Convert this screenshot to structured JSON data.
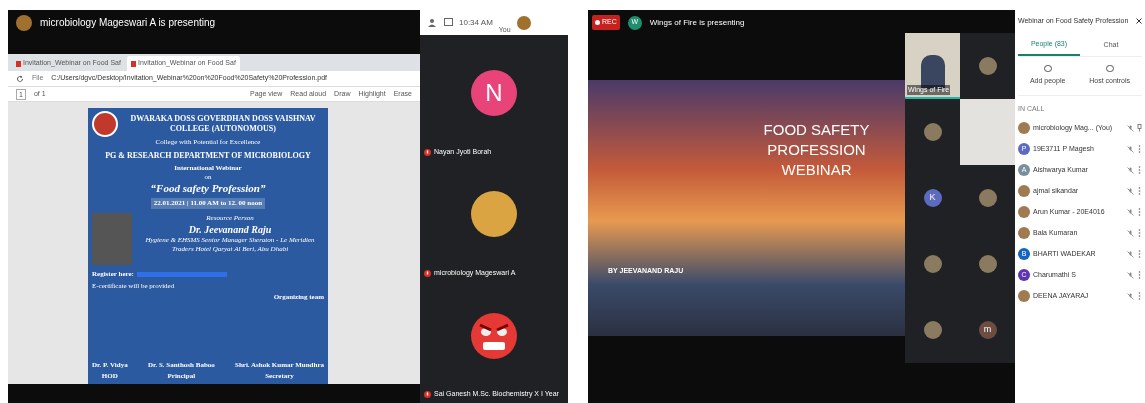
{
  "left_meeting": {
    "presenter_banner": "microbiology Mageswari A is presenting",
    "clock": "10:34 AM",
    "self_label": "You",
    "browser": {
      "tabs": [
        {
          "label": "Invitation_Webinar on Food Saf",
          "selected": false
        },
        {
          "label": "Invitation_Webinar on Food Saf",
          "selected": true
        }
      ],
      "file_label": "File",
      "address": "C:/Users/dgvc/Desktop/Invitation_Webinar%20on%20Food%20Safety%20Profession.pdf",
      "page_number": "1",
      "page_count": "of 1",
      "toolbar": [
        "Page view",
        "Read aloud",
        "Draw",
        "Highlight",
        "Erase"
      ]
    },
    "poster": {
      "college": "DWARAKA DOSS GOVERDHAN DOSS VAISHNAV COLLEGE (AUTONOMOUS)",
      "tagline": "College with Potential for Excellence",
      "department": "PG & RESEARCH DEPARTMENT OF MICROBIOLOGY",
      "event": "International Webinar",
      "on": "on",
      "topic": "“Food safety Profession”",
      "date": "22.01.2021 | 11.00 AM to 12. 00 noon",
      "resource_label": "Resource Person",
      "speaker": "Dr. Jeevanand Raju",
      "speaker_details": "Hygiene & EHSMS Senior Manager Sheraton - Le Meridien Traders Hotel Qaryat Al Beri, Abu Dhabi",
      "register": "Register here:",
      "certificate": "E-certificate will be provided",
      "organizing": "Organizing team",
      "signatories": [
        {
          "name": "Dr. P. Vidya",
          "role": "HOD"
        },
        {
          "name": "Dr. S. Santhosh Baboo",
          "role": "Principal"
        },
        {
          "name": "Shri. Ashok Kumar Mundhra",
          "role": "Secretary"
        }
      ]
    },
    "tiles": [
      {
        "name": "Nayan Jyoti Borah",
        "kind": "initial",
        "initial": "N",
        "color": "#e8447a"
      },
      {
        "name": "microbiology Mageswari A",
        "kind": "photo"
      },
      {
        "name": "Sai Ganesh M.Sc. Biochemistry X I Year",
        "kind": "emoji"
      }
    ]
  },
  "right_meeting": {
    "rec": "REC",
    "presenter_initial": "W",
    "presenter_banner": "Wings of Fire is presenting",
    "slide": {
      "title": "FOOD SAFETY PROFESSION WEBINAR",
      "byline": "BY JEEVANAND RAJU"
    },
    "tiles": [
      {
        "kind": "video",
        "name": "Wings of Fire",
        "speaking": true
      },
      {
        "kind": "photo",
        "speaking": false
      },
      {
        "kind": "photo",
        "speaking": false
      },
      {
        "kind": "blank-video",
        "speaking": false
      },
      {
        "kind": "initial",
        "initial": "K",
        "color": "#5c6bc0",
        "speaking": false
      },
      {
        "kind": "photo",
        "speaking": false
      },
      {
        "kind": "photo",
        "speaking": false
      },
      {
        "kind": "photo",
        "speaking": false
      },
      {
        "kind": "photo",
        "speaking": false
      },
      {
        "kind": "initial",
        "initial": "m",
        "color": "#6d4c41",
        "speaking": false
      }
    ],
    "sidebar": {
      "title": "Webinar on Food Safety Profession",
      "tabs": [
        {
          "label": "People (83)",
          "selected": true
        },
        {
          "label": "Chat",
          "selected": false
        }
      ],
      "actions": [
        "Add people",
        "Host controls"
      ],
      "section": "IN CALL",
      "people": [
        {
          "name": "microbiology Mag... (You)",
          "kind": "photo",
          "you": true
        },
        {
          "name": "19E3711 P Magesh",
          "kind": "initial",
          "initial": "P",
          "color": "#5c6bc0",
          "you": false
        },
        {
          "name": "Aishwarya Kumar",
          "kind": "initial",
          "initial": "A",
          "color": "#78909c",
          "you": false
        },
        {
          "name": "ajmal sikandar",
          "kind": "photo",
          "you": false
        },
        {
          "name": "Arun Kumar - 20E4016",
          "kind": "photo",
          "you": false
        },
        {
          "name": "Bala Kumaran",
          "kind": "photo",
          "you": false
        },
        {
          "name": "BHARTI WADEKAR",
          "kind": "initial",
          "initial": "B",
          "color": "#1565c0",
          "you": false
        },
        {
          "name": "Charumathi S",
          "kind": "initial",
          "initial": "C",
          "color": "#5e35b1",
          "you": false
        },
        {
          "name": "DEENA JAYARAJ",
          "kind": "photo",
          "you": false
        }
      ]
    }
  }
}
